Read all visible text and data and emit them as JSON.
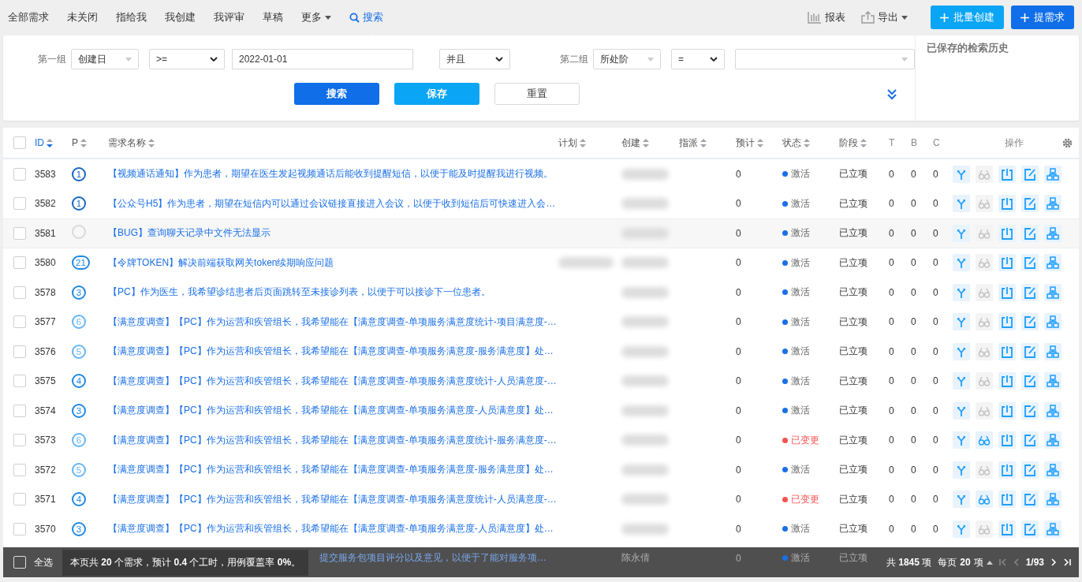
{
  "nav": {
    "tabs": [
      {
        "label": "全部需求",
        "selected": false
      },
      {
        "label": "未关闭",
        "selected": false
      },
      {
        "label": "指给我",
        "selected": false
      },
      {
        "label": "我创建",
        "selected": false
      },
      {
        "label": "我评审",
        "selected": false
      },
      {
        "label": "草稿",
        "selected": false
      },
      {
        "label": "更多",
        "selected": false,
        "kind": "menu"
      },
      {
        "label": "搜索",
        "selected": true,
        "kind": "search"
      }
    ],
    "report": "报表",
    "export": "导出",
    "batch_create": "批量创建",
    "new_request": "提需求"
  },
  "filter": {
    "group1_label": "第一组",
    "group1_field": "创建日",
    "group1_op": ">=",
    "group1_value": "2022-01-01",
    "logic": "并且",
    "group2_label": "第二组",
    "group2_field": "所处阶",
    "group2_op": "=",
    "search": "搜索",
    "save": "保存",
    "reset": "重置",
    "history_title": "已保存的检索历史"
  },
  "table": {
    "select_all_checked": false,
    "columns": [
      {
        "label": "ID",
        "sortable": true,
        "sort_active": true
      },
      {
        "label": "P",
        "sortable": true,
        "sort_active": false
      },
      {
        "label": "需求名称",
        "sortable": true,
        "sort_active": false
      },
      {
        "label": "计划",
        "sortable": true,
        "sort_active": false
      },
      {
        "label": "创建",
        "sortable": true,
        "sort_active": false
      },
      {
        "label": "指派",
        "sortable": true,
        "sort_active": false
      },
      {
        "label": "预计",
        "sortable": true,
        "sort_active": false
      },
      {
        "label": "状态",
        "sortable": true,
        "sort_active": false
      },
      {
        "label": "阶段",
        "sortable": true,
        "sort_active": false
      },
      {
        "label": "T",
        "sortable": false,
        "sort_active": false
      },
      {
        "label": "B",
        "sortable": false,
        "sort_active": false
      },
      {
        "label": "C",
        "sortable": false,
        "sort_active": false
      },
      {
        "label": "操作",
        "sortable": false,
        "sort_active": false
      }
    ],
    "rows": [
      {
        "checked": false,
        "id": "3583",
        "priority": "1",
        "color": "#1565c0",
        "name": "【视频通话通知】作为患者，期望在医生发起视频通话后能收到提醒短信，以便于能及时提醒我进行视频。",
        "plan_blurred": false,
        "estimate": "0",
        "status": "激活",
        "status_changed": false,
        "stage": "已立项",
        "t": "0",
        "b": "0",
        "c": "0",
        "review_enabled": false,
        "highlighted": false
      },
      {
        "checked": false,
        "id": "3582",
        "priority": "1",
        "color": "#1565c0",
        "name": "【公众号H5】作为患者，期望在短信内可以通过会议链接直接进入会议，以便于收到短信后可快速进入会…",
        "plan_blurred": false,
        "estimate": "0",
        "status": "激活",
        "status_changed": false,
        "stage": "已立项",
        "t": "0",
        "b": "0",
        "c": "0",
        "review_enabled": false,
        "highlighted": false
      },
      {
        "checked": false,
        "id": "3581",
        "color": "#d9d9d9",
        "name": "【BUG】查询聊天记录中文件无法显示",
        "plan_blurred": false,
        "estimate": "0",
        "status": "激活",
        "status_changed": false,
        "stage": "已立项",
        "t": "0",
        "b": "0",
        "c": "0",
        "review_enabled": false,
        "highlighted": true
      },
      {
        "checked": false,
        "id": "3580",
        "priority": "21",
        "color": "#1e88e5",
        "name": "【令牌TOKEN】解决前端获取网关token续期响应问题",
        "plan_blurred": true,
        "estimate": "0",
        "status": "激活",
        "status_changed": false,
        "stage": "已立项",
        "t": "0",
        "b": "0",
        "c": "0",
        "review_enabled": false,
        "highlighted": false
      },
      {
        "checked": false,
        "id": "3578",
        "priority": "3",
        "color": "#1e88e5",
        "name": "【PC】作为医生，我希望诊结患者后页面跳转至未接诊列表，以便于可以接诊下一位患者。",
        "plan_blurred": false,
        "estimate": "0",
        "status": "激活",
        "status_changed": false,
        "stage": "已立项",
        "t": "0",
        "b": "0",
        "c": "0",
        "review_enabled": false,
        "highlighted": false
      },
      {
        "checked": false,
        "id": "3577",
        "priority": "6",
        "color": "#64b5f6",
        "name": "【满意度调查】【PC】作为运营和疾管组长，我希望能在【满意度调查-单项服务满意度统计-项目满意度-…",
        "plan_blurred": false,
        "estimate": "0",
        "status": "激活",
        "status_changed": false,
        "stage": "已立项",
        "t": "0",
        "b": "0",
        "c": "0",
        "review_enabled": false,
        "highlighted": false
      },
      {
        "checked": false,
        "id": "3576",
        "priority": "5",
        "color": "#64b5f6",
        "name": "【满意度调查】【PC】作为运营和疾管组长，我希望能在【满意度调查-单项服务满意度-服务满意度】处…",
        "plan_blurred": false,
        "estimate": "0",
        "status": "激活",
        "status_changed": false,
        "stage": "已立项",
        "t": "0",
        "b": "0",
        "c": "0",
        "review_enabled": false,
        "highlighted": false
      },
      {
        "checked": false,
        "id": "3575",
        "priority": "4",
        "color": "#1e88e5",
        "name": "【满意度调查】【PC】作为运营和疾管组长，我希望能在【满意度调查-单项服务满意度统计-人员满意度-…",
        "plan_blurred": false,
        "estimate": "0",
        "status": "激活",
        "status_changed": false,
        "stage": "已立项",
        "t": "0",
        "b": "0",
        "c": "0",
        "review_enabled": false,
        "highlighted": false
      },
      {
        "checked": false,
        "id": "3574",
        "priority": "3",
        "color": "#1e88e5",
        "name": "【满意度调查】【PC】作为运营和疾管组长，我希望能在【满意度调查-单项服务满意度-人员满意度】处…",
        "plan_blurred": false,
        "estimate": "0",
        "status": "激活",
        "status_changed": false,
        "stage": "已立项",
        "t": "0",
        "b": "0",
        "c": "0",
        "review_enabled": false,
        "highlighted": false
      },
      {
        "checked": false,
        "id": "3573",
        "priority": "6",
        "color": "#64b5f6",
        "name": "【满意度调查】【PC】作为运营和疾管组长，我希望能在【满意度调查-单项服务满意度统计-服务满意度-…",
        "plan_blurred": false,
        "estimate": "0",
        "status": "已变更",
        "status_changed": true,
        "stage": "已立项",
        "t": "0",
        "b": "0",
        "c": "0",
        "review_enabled": true,
        "highlighted": false
      },
      {
        "checked": false,
        "id": "3572",
        "priority": "5",
        "color": "#64b5f6",
        "name": "【满意度调查】【PC】作为运营和疾管组长，我希望能在【满意度调查-单项服务满意度-服务满意度】处…",
        "plan_blurred": false,
        "estimate": "0",
        "status": "激活",
        "status_changed": false,
        "stage": "已立项",
        "t": "0",
        "b": "0",
        "c": "0",
        "review_enabled": false,
        "highlighted": false
      },
      {
        "checked": false,
        "id": "3571",
        "priority": "4",
        "color": "#1e88e5",
        "name": "【满意度调查】【PC】作为运营和疾管组长，我希望能在【满意度调查-单项服务满意度统计-人员满意度-…",
        "plan_blurred": false,
        "estimate": "0",
        "status": "已变更",
        "status_changed": true,
        "stage": "已立项",
        "t": "0",
        "b": "0",
        "c": "0",
        "review_enabled": true,
        "highlighted": false
      },
      {
        "checked": false,
        "id": "3570",
        "priority": "3",
        "color": "#1e88e5",
        "name": "【满意度调查】【PC】作为运营和疾管组长，我希望能在【满意度调查-单项服务满意度-人员满意度】处…",
        "plan_blurred": false,
        "estimate": "0",
        "status": "激活",
        "status_changed": false,
        "stage": "已立项",
        "t": "0",
        "b": "0",
        "c": "0",
        "review_enabled": false,
        "highlighted": false
      }
    ],
    "covered_row": {
      "name": "提交服务包项目评分以及意见，以便于了能对服务项…",
      "creator": "陈永倩",
      "estimate": "0",
      "status": "激活",
      "stage": "已立项"
    }
  },
  "footer": {
    "select_all": "全选",
    "select_all_checked": false,
    "summary": "本页共 **20** 个需求，预计 **0.4** 个工时，用例覆盖率 **0%**。",
    "total": "共 **1845** 项",
    "per_page": "每页 **20** 项",
    "page": "1/93"
  }
}
